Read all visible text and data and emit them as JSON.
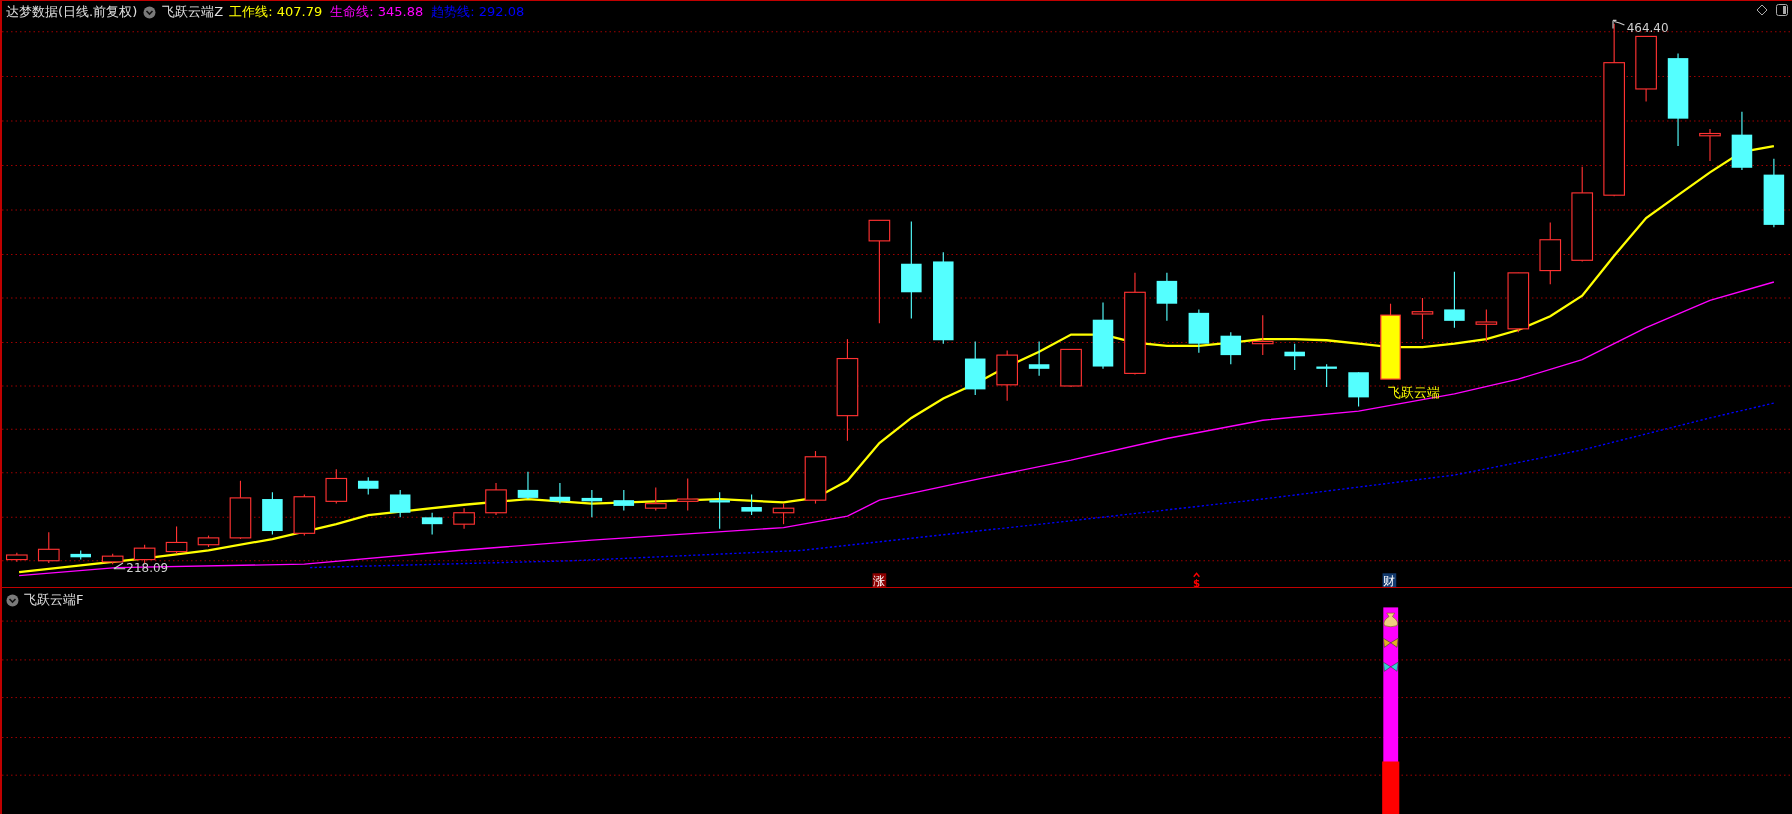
{
  "main_panel": {
    "source_label": "达梦数据(日线.前复权)",
    "indicator": {
      "name": "飞跃云端Z",
      "lines": [
        {
          "label": "工作线: 407.79",
          "color": "#ffff00",
          "kind": "solid"
        },
        {
          "label": "生命线: 345.88",
          "color": "#ff00ff",
          "kind": "solid"
        },
        {
          "label": "趋势线: 292.08",
          "color": "#0000ff",
          "kind": "dotted"
        }
      ]
    },
    "high_label": "464.40",
    "low_label": "218.09",
    "signal_label": "飞跃云端",
    "markers": [
      {
        "kind": "tag",
        "text": "涨",
        "color": "#8b0000"
      },
      {
        "kind": "dollar",
        "text": "$",
        "color": "#ff0000"
      },
      {
        "kind": "tag",
        "text": "财",
        "color": "#123a6e"
      }
    ]
  },
  "sub_panel": {
    "indicator": {
      "name": "飞跃云端F"
    }
  }
}
